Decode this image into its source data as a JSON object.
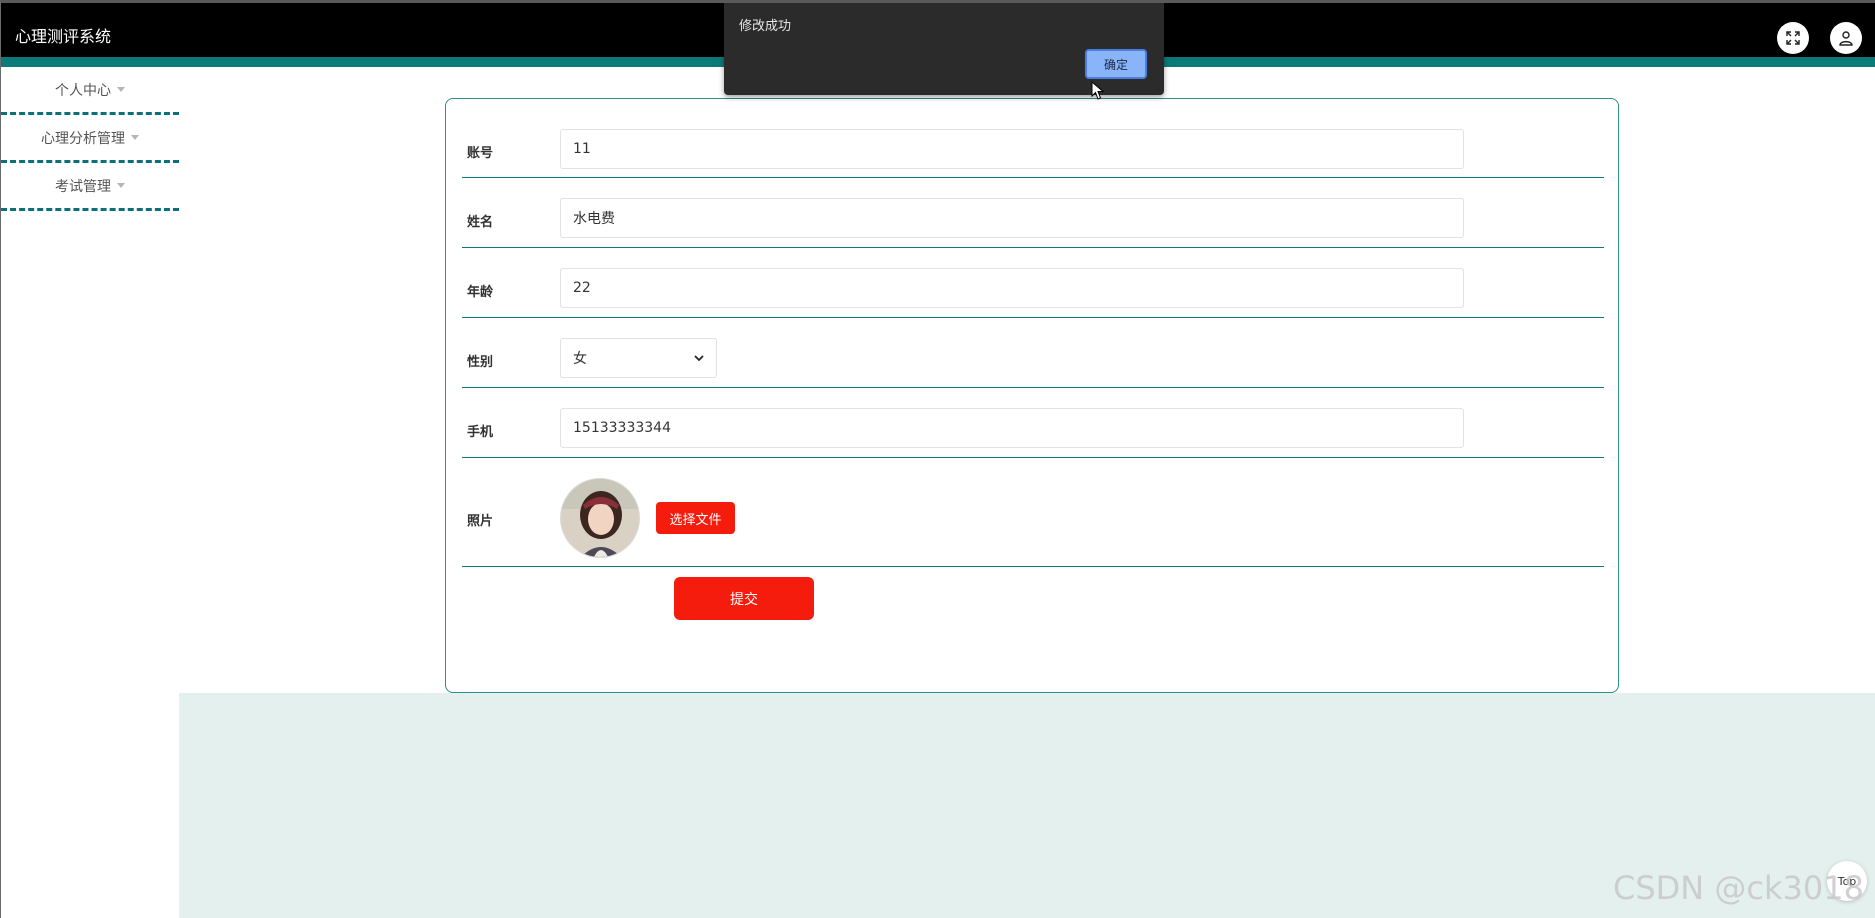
{
  "app": {
    "title": "心理测评系统"
  },
  "header": {
    "fullscreen_icon": "fullscreen-icon",
    "user_icon": "user-icon"
  },
  "sidebar": {
    "items": [
      {
        "label": "个人中心"
      },
      {
        "label": "心理分析管理"
      },
      {
        "label": "考试管理"
      }
    ]
  },
  "form": {
    "fields": {
      "account": {
        "label": "账号",
        "value": "11"
      },
      "name": {
        "label": "姓名",
        "value": "水电费"
      },
      "age": {
        "label": "年龄",
        "value": "22"
      },
      "gender": {
        "label": "性别",
        "selected": "女"
      },
      "phone": {
        "label": "手机",
        "value": "15133333344"
      },
      "photo": {
        "label": "照片",
        "file_button": "选择文件"
      }
    },
    "submit_label": "提交"
  },
  "alert": {
    "message": "修改成功",
    "ok_label": "确定"
  },
  "back_to_top": {
    "label": "Top"
  },
  "watermark": {
    "text": "CSDN @ck3018"
  },
  "colors": {
    "header_bg": "#000000",
    "accent_teal": "#0d7a7a",
    "button_red": "#f61c0d",
    "bottom_bg": "#e3f0ee",
    "dialog_bg": "#2b2b2b",
    "dialog_button": "#8ab4f8"
  }
}
